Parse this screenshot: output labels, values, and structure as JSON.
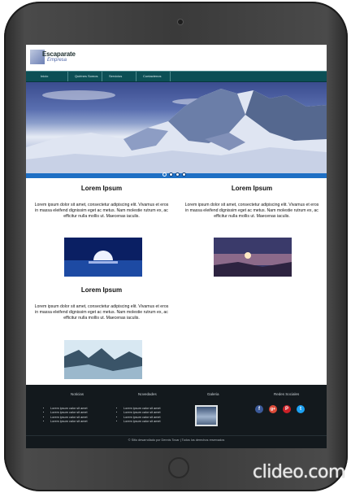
{
  "logo": {
    "title": "Escaparate",
    "subtitle": "Empresa"
  },
  "nav": {
    "items": [
      "Inicio",
      "Quiénes Somos",
      "Servicios",
      "Contactenos"
    ]
  },
  "slider": {
    "dots": 4,
    "active": 0
  },
  "sections": [
    {
      "title": "Lorem Ipsum",
      "text": "Lorem ipsum dolor sit amet, consectetur adipiscing elit. Vivamus et eros in massa eleifend dignissim eget ac metus. Nam molestie rutrum ex, ac efficitur nulla mollis ut. Maecenas iaculis."
    },
    {
      "title": "Lorem Ipsum",
      "text": "Lorem ipsum dolor sit amet, consectetur adipiscing elit. Vivamus et eros in massa eleifend dignissim eget ac metus. Nam molestie rutrum ex, ac efficitur nulla mollis ut. Maecenas iaculis."
    },
    {
      "title": "Lorem Ipsum",
      "text": "Lorem ipsum dolor sit amet, consectetur adipiscing elit. Vivamus et eros in massa eleifend dignissim eget ac metus. Nam molestie rutrum ex, ac efficitur nulla mollis ut. Maecenas iaculis."
    }
  ],
  "footer": {
    "noticias": {
      "title": "Noticias",
      "items": [
        "Lorem ipsum calor sit amet",
        "Lorem ipsum calor sit amet",
        "Lorem ipsum calor sit amet",
        "Lorem ipsum calor sit amet"
      ]
    },
    "novedades": {
      "title": "Novedades",
      "items": [
        "Lorem ipsum calor sit amet",
        "Lorem ipsum calor sit amet",
        "Lorem ipsum calor sit amet",
        "Lorem ipsum calor sit amet"
      ]
    },
    "galeria": {
      "title": "Galeria"
    },
    "redes": {
      "title": "Redes Sociales",
      "icons": [
        {
          "name": "facebook-icon",
          "glyph": "f",
          "color": "#3b5998"
        },
        {
          "name": "google-plus-icon",
          "glyph": "g+",
          "color": "#dd4b39"
        },
        {
          "name": "pinterest-icon",
          "glyph": "P",
          "color": "#cb2027"
        },
        {
          "name": "twitter-icon",
          "glyph": "t",
          "color": "#1da1f2"
        }
      ]
    },
    "copyright": "© Sitio desarrollado por Dennis Tovar | Todos los derechos reservados"
  },
  "watermark": "clideo.com"
}
